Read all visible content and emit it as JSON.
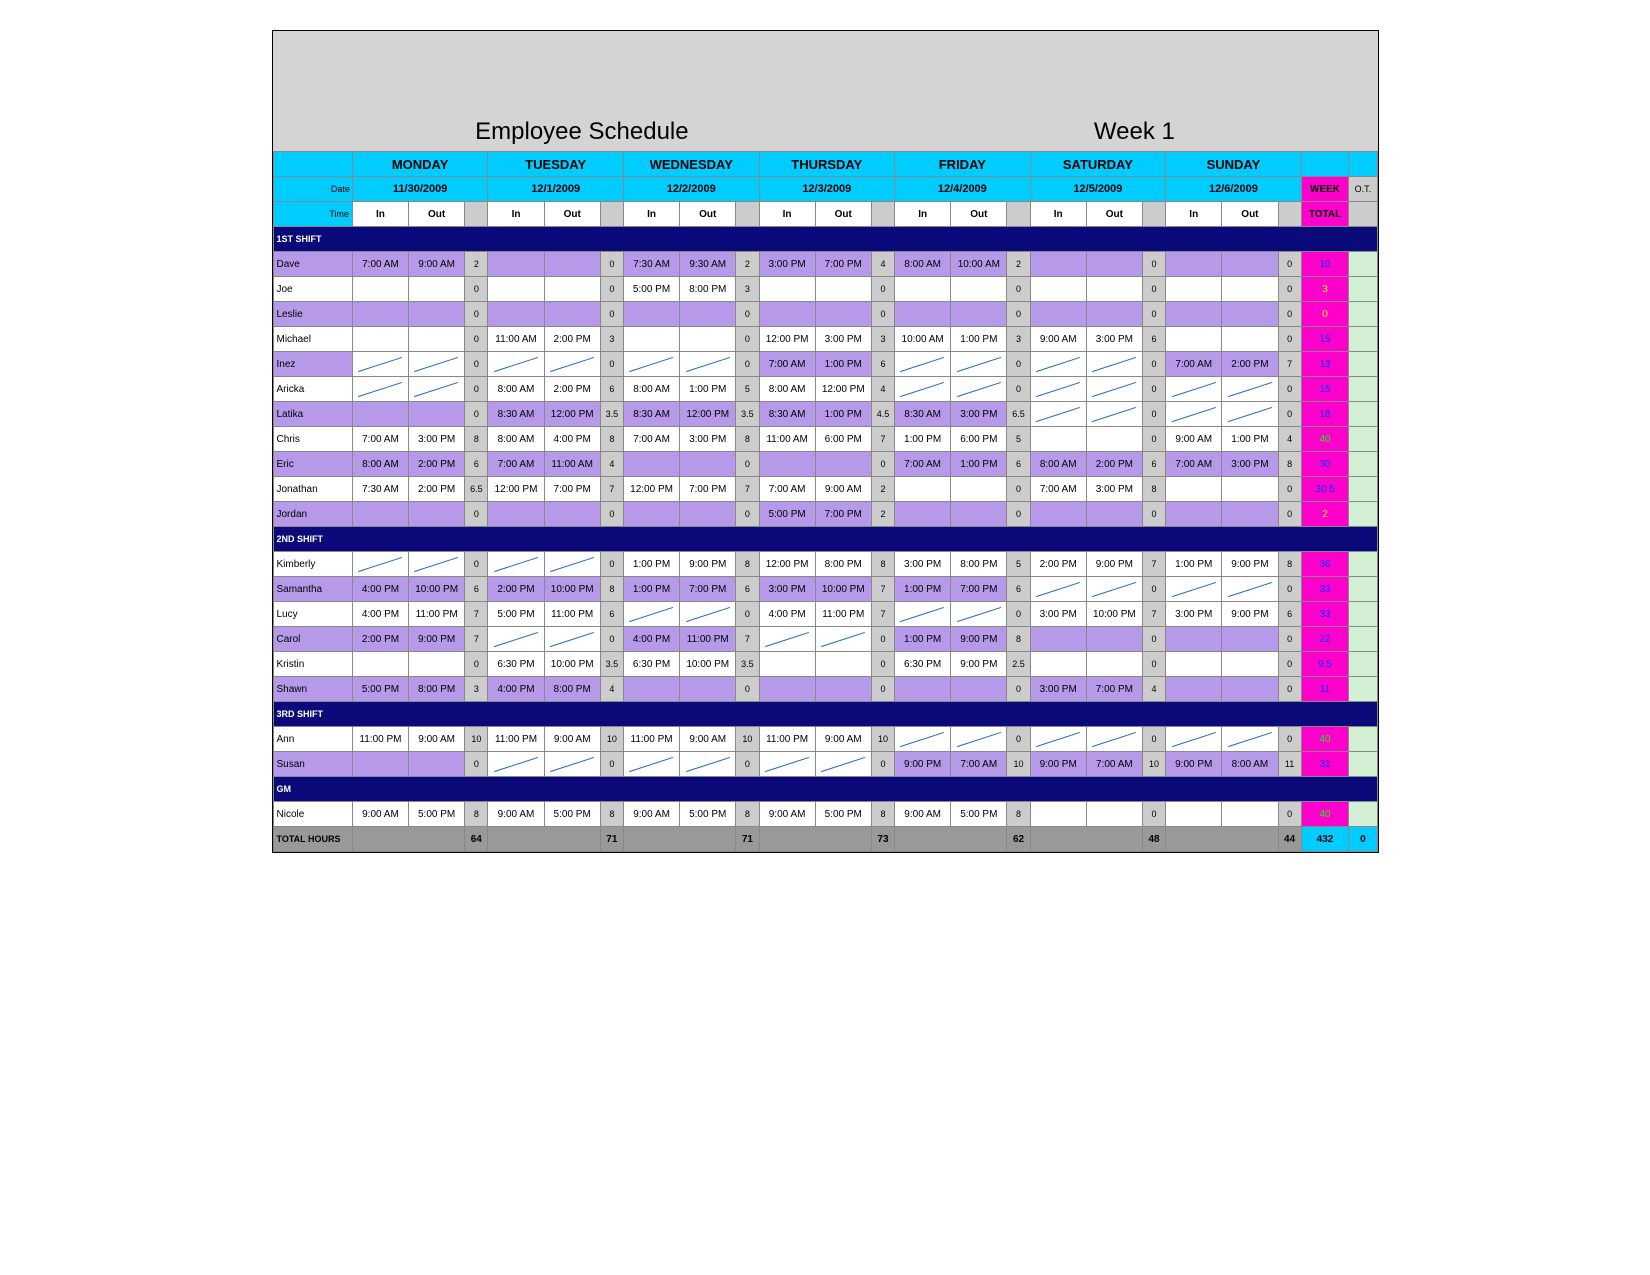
{
  "title": "Employee Schedule",
  "week": "Week 1",
  "labels": {
    "date": "Date",
    "time": "Time",
    "in": "In",
    "out": "Out",
    "week": "WEEK",
    "ot": "O.T.",
    "total": "TOTAL",
    "total_hours": "TOTAL HOURS"
  },
  "days": [
    {
      "name": "MONDAY",
      "date": "11/30/2009"
    },
    {
      "name": "TUESDAY",
      "date": "12/1/2009"
    },
    {
      "name": "WEDNESDAY",
      "date": "12/2/2009"
    },
    {
      "name": "THURSDAY",
      "date": "12/3/2009"
    },
    {
      "name": "FRIDAY",
      "date": "12/4/2009"
    },
    {
      "name": "SATURDAY",
      "date": "12/5/2009"
    },
    {
      "name": "SUNDAY",
      "date": "12/6/2009"
    }
  ],
  "sections": [
    {
      "label": "1ST SHIFT",
      "rows": [
        {
          "name": "Dave",
          "alt": 0,
          "d": [
            [
              "7:00 AM",
              "9:00 AM",
              2
            ],
            [
              "",
              "",
              0
            ],
            [
              "7:30 AM",
              "9:30 AM",
              2
            ],
            [
              "3:00 PM",
              "7:00 PM",
              4
            ],
            [
              "8:00 AM",
              "10:00 AM",
              2
            ],
            [
              "",
              "",
              0
            ],
            [
              "",
              "",
              0
            ]
          ],
          "wk": 10,
          "wkc": ""
        },
        {
          "name": "Joe",
          "alt": 1,
          "d": [
            [
              "",
              "",
              0
            ],
            [
              "",
              "",
              0
            ],
            [
              "5:00 PM",
              "8:00 PM",
              3
            ],
            [
              "",
              "",
              0
            ],
            [
              "",
              "",
              0
            ],
            [
              "",
              "",
              0
            ],
            [
              "",
              "",
              0
            ]
          ],
          "wk": 3,
          "wkc": "y"
        },
        {
          "name": "Leslie",
          "alt": 0,
          "d": [
            [
              "",
              "",
              0
            ],
            [
              "",
              "",
              0
            ],
            [
              "",
              "",
              0
            ],
            [
              "",
              "",
              0
            ],
            [
              "",
              "",
              0
            ],
            [
              "",
              "",
              0
            ],
            [
              "",
              "",
              0
            ]
          ],
          "wk": 0,
          "wkc": "y"
        },
        {
          "name": "Michael",
          "alt": 1,
          "d": [
            [
              "",
              "",
              0
            ],
            [
              "11:00 AM",
              "2:00 PM",
              3
            ],
            [
              "",
              "",
              0
            ],
            [
              "12:00 PM",
              "3:00 PM",
              3
            ],
            [
              "10:00 AM",
              "1:00 PM",
              3
            ],
            [
              "9:00 AM",
              "3:00 PM",
              6
            ],
            [
              "",
              "",
              0
            ]
          ],
          "wk": 15,
          "wkc": ""
        },
        {
          "name": "Inez",
          "alt": 0,
          "d": [
            [
              "/",
              "/",
              0
            ],
            [
              "/",
              "/",
              0
            ],
            [
              "/",
              "/",
              0
            ],
            [
              "7:00 AM",
              "1:00 PM",
              6
            ],
            [
              "/",
              "/",
              0
            ],
            [
              "/",
              "/",
              0
            ],
            [
              "7:00 AM",
              "2:00 PM",
              7
            ]
          ],
          "wk": 13,
          "wkc": ""
        },
        {
          "name": "Aricka",
          "alt": 1,
          "d": [
            [
              "/",
              "/",
              0
            ],
            [
              "8:00 AM",
              "2:00 PM",
              6
            ],
            [
              "8:00 AM",
              "1:00 PM",
              5
            ],
            [
              "8:00 AM",
              "12:00 PM",
              4
            ],
            [
              "/",
              "/",
              0
            ],
            [
              "/",
              "/",
              0
            ],
            [
              "/",
              "/",
              0
            ]
          ],
          "wk": 15,
          "wkc": ""
        },
        {
          "name": "Latika",
          "alt": 0,
          "d": [
            [
              "",
              "",
              0
            ],
            [
              "8:30 AM",
              "12:00 PM",
              3.5
            ],
            [
              "8:30 AM",
              "12:00 PM",
              3.5
            ],
            [
              "8:30 AM",
              "1:00 PM",
              4.5
            ],
            [
              "8:30 AM",
              "3:00 PM",
              6.5
            ],
            [
              "/",
              "/",
              0
            ],
            [
              "/",
              "/",
              0
            ]
          ],
          "wk": 18,
          "wkc": ""
        },
        {
          "name": "Chris",
          "alt": 1,
          "d": [
            [
              "7:00 AM",
              "3:00 PM",
              8
            ],
            [
              "8:00 AM",
              "4:00 PM",
              8
            ],
            [
              "7:00 AM",
              "3:00 PM",
              8
            ],
            [
              "11:00 AM",
              "6:00 PM",
              7
            ],
            [
              "1:00 PM",
              "6:00 PM",
              5
            ],
            [
              "",
              "",
              0
            ],
            [
              "9:00 AM",
              "1:00 PM",
              4
            ]
          ],
          "wk": 40,
          "wkc": "g"
        },
        {
          "name": "Eric",
          "alt": 0,
          "d": [
            [
              "8:00 AM",
              "2:00 PM",
              6
            ],
            [
              "7:00 AM",
              "11:00 AM",
              4
            ],
            [
              "",
              "",
              0
            ],
            [
              "",
              "",
              0
            ],
            [
              "7:00 AM",
              "1:00 PM",
              6
            ],
            [
              "8:00 AM",
              "2:00 PM",
              6
            ],
            [
              "7:00 AM",
              "3:00 PM",
              8
            ]
          ],
          "wk": 30,
          "wkc": ""
        },
        {
          "name": "Jonathan",
          "alt": 1,
          "d": [
            [
              "7:30 AM",
              "2:00 PM",
              6.5
            ],
            [
              "12:00 PM",
              "7:00 PM",
              7
            ],
            [
              "12:00 PM",
              "7:00 PM",
              7
            ],
            [
              "7:00 AM",
              "9:00 AM",
              2
            ],
            [
              "",
              "",
              0
            ],
            [
              "7:00 AM",
              "3:00 PM",
              8
            ],
            [
              "",
              "",
              0
            ]
          ],
          "wk": 30.5,
          "wkc": ""
        },
        {
          "name": "Jordan",
          "alt": 0,
          "d": [
            [
              "",
              "",
              0
            ],
            [
              "",
              "",
              0
            ],
            [
              "",
              "",
              0
            ],
            [
              "5:00 PM",
              "7:00 PM",
              2
            ],
            [
              "",
              "",
              0
            ],
            [
              "",
              "",
              0
            ],
            [
              "",
              "",
              0
            ]
          ],
          "wk": 2,
          "wkc": "y"
        }
      ]
    },
    {
      "label": "2ND SHIFT",
      "rows": [
        {
          "name": "Kimberly",
          "alt": 1,
          "d": [
            [
              "/",
              "/",
              0
            ],
            [
              "/",
              "/",
              0
            ],
            [
              "1:00 PM",
              "9:00 PM",
              8
            ],
            [
              "12:00 PM",
              "8:00 PM",
              8
            ],
            [
              "3:00 PM",
              "8:00 PM",
              5
            ],
            [
              "2:00 PM",
              "9:00 PM",
              7
            ],
            [
              "1:00 PM",
              "9:00 PM",
              8
            ]
          ],
          "wk": 36,
          "wkc": ""
        },
        {
          "name": "Samantha",
          "alt": 0,
          "d": [
            [
              "4:00 PM",
              "10:00 PM",
              6
            ],
            [
              "2:00 PM",
              "10:00 PM",
              8
            ],
            [
              "1:00 PM",
              "7:00 PM",
              6
            ],
            [
              "3:00 PM",
              "10:00 PM",
              7
            ],
            [
              "1:00 PM",
              "7:00 PM",
              6
            ],
            [
              "/",
              "/",
              0
            ],
            [
              "/",
              "/",
              0
            ]
          ],
          "wk": 33,
          "wkc": ""
        },
        {
          "name": "Lucy",
          "alt": 1,
          "d": [
            [
              "4:00 PM",
              "11:00 PM",
              7
            ],
            [
              "5:00 PM",
              "11:00 PM",
              6
            ],
            [
              "/",
              "/",
              0
            ],
            [
              "4:00 PM",
              "11:00 PM",
              7
            ],
            [
              "/",
              "/",
              0
            ],
            [
              "3:00 PM",
              "10:00 PM",
              7
            ],
            [
              "3:00 PM",
              "9:00 PM",
              6
            ]
          ],
          "wk": 33,
          "wkc": ""
        },
        {
          "name": "Carol",
          "alt": 0,
          "d": [
            [
              "2:00 PM",
              "9:00 PM",
              7
            ],
            [
              "/",
              "/",
              0
            ],
            [
              "4:00 PM",
              "11:00 PM",
              7
            ],
            [
              "/",
              "/",
              0
            ],
            [
              "1:00 PM",
              "9:00 PM",
              8
            ],
            [
              "",
              "",
              0
            ],
            [
              "",
              "",
              0
            ]
          ],
          "wk": 22,
          "wkc": ""
        },
        {
          "name": "Kristin",
          "alt": 1,
          "d": [
            [
              "",
              "",
              0
            ],
            [
              "6:30 PM",
              "10:00 PM",
              3.5
            ],
            [
              "6:30 PM",
              "10:00 PM",
              3.5
            ],
            [
              "",
              "",
              0
            ],
            [
              "6:30 PM",
              "9:00 PM",
              2.5
            ],
            [
              "",
              "",
              0
            ],
            [
              "",
              "",
              0
            ]
          ],
          "wk": 9.5,
          "wkc": ""
        },
        {
          "name": "Shawn",
          "alt": 0,
          "d": [
            [
              "5:00 PM",
              "8:00 PM",
              3
            ],
            [
              "4:00 PM",
              "8:00 PM",
              4
            ],
            [
              "",
              "",
              0
            ],
            [
              "",
              "",
              0
            ],
            [
              "",
              "",
              0
            ],
            [
              "3:00 PM",
              "7:00 PM",
              4
            ],
            [
              "",
              "",
              0
            ]
          ],
          "wk": 11,
          "wkc": ""
        }
      ]
    },
    {
      "label": "3RD SHIFT",
      "rows": [
        {
          "name": "Ann",
          "alt": 1,
          "d": [
            [
              "11:00 PM",
              "9:00 AM",
              10
            ],
            [
              "11:00 PM",
              "9:00 AM",
              10
            ],
            [
              "11:00 PM",
              "9:00 AM",
              10
            ],
            [
              "11:00 PM",
              "9:00 AM",
              10
            ],
            [
              "/",
              "/",
              0
            ],
            [
              "/",
              "/",
              0
            ],
            [
              "/",
              "/",
              0
            ]
          ],
          "wk": 40,
          "wkc": "g"
        },
        {
          "name": "Susan",
          "alt": 0,
          "d": [
            [
              "",
              "",
              0
            ],
            [
              "/",
              "/",
              0
            ],
            [
              "/",
              "/",
              0
            ],
            [
              "/",
              "/",
              0
            ],
            [
              "9:00 PM",
              "7:00 AM",
              10
            ],
            [
              "9:00 PM",
              "7:00 AM",
              10
            ],
            [
              "9:00 PM",
              "8:00 AM",
              11
            ]
          ],
          "wk": 31,
          "wkc": ""
        }
      ]
    },
    {
      "label": "GM",
      "rows": [
        {
          "name": "Nicole",
          "alt": 1,
          "d": [
            [
              "9:00 AM",
              "5:00 PM",
              8
            ],
            [
              "9:00 AM",
              "5:00 PM",
              8
            ],
            [
              "9:00 AM",
              "5:00 PM",
              8
            ],
            [
              "9:00 AM",
              "5:00 PM",
              8
            ],
            [
              "9:00 AM",
              "5:00 PM",
              8
            ],
            [
              "",
              "",
              0
            ],
            [
              "",
              "",
              0
            ]
          ],
          "wk": 40,
          "wkc": "g"
        }
      ]
    }
  ],
  "totals": {
    "days": [
      64,
      71,
      71,
      73,
      62,
      48,
      44
    ],
    "week": 432,
    "ot": 0
  }
}
